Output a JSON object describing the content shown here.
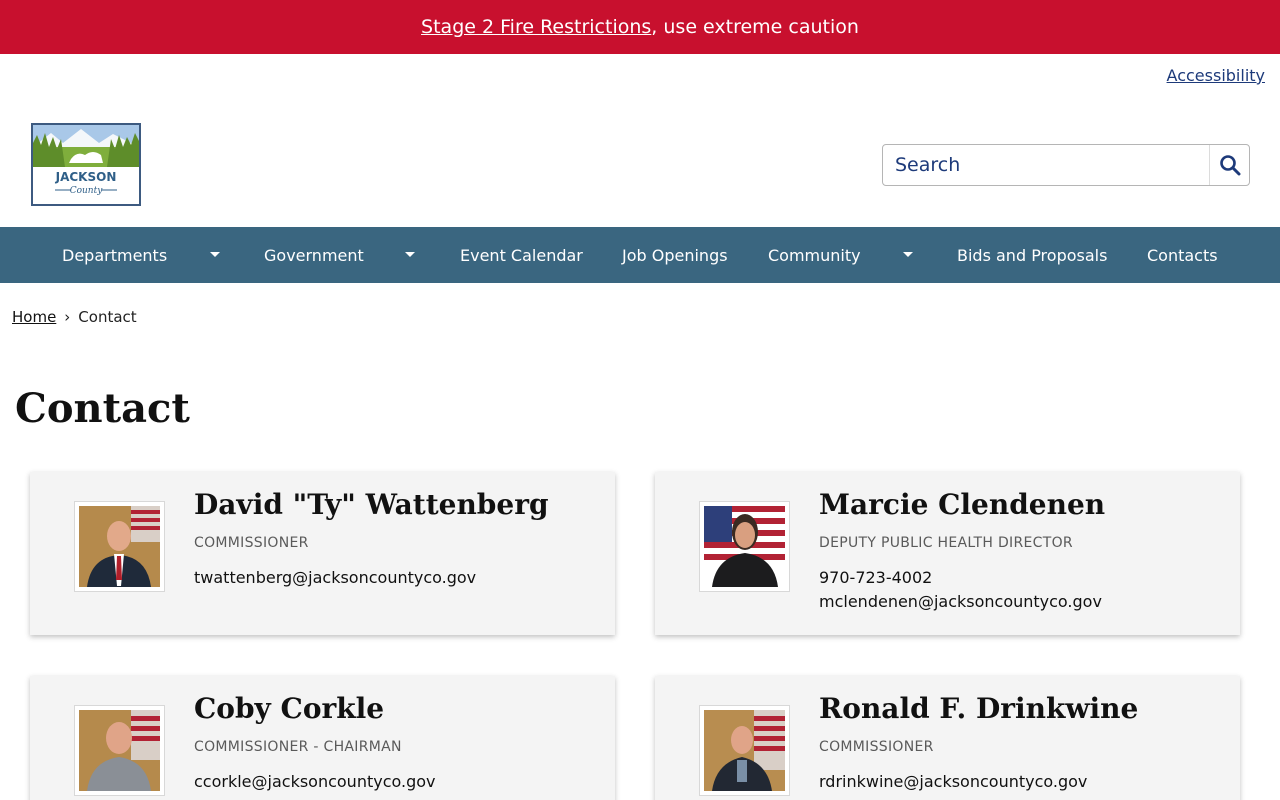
{
  "alert": {
    "link_text": "Stage 2 Fire Restrictions",
    "rest_text": ", use extreme caution"
  },
  "header": {
    "accessibility_label": "Accessibility",
    "logo_text": "JACKSON",
    "logo_subtext": "County",
    "search_placeholder": "Search"
  },
  "nav": {
    "items": [
      {
        "label": "Departments",
        "has_dropdown": true
      },
      {
        "label": "Government",
        "has_dropdown": true
      },
      {
        "label": "Event Calendar",
        "has_dropdown": false
      },
      {
        "label": "Job Openings",
        "has_dropdown": false
      },
      {
        "label": "Community",
        "has_dropdown": true
      },
      {
        "label": "Bids and Proposals",
        "has_dropdown": false
      },
      {
        "label": "Contacts",
        "has_dropdown": false
      }
    ]
  },
  "breadcrumb": {
    "home": "Home",
    "separator": "›",
    "current": "Contact"
  },
  "page": {
    "title": "Contact"
  },
  "contacts": [
    {
      "name": "David \"Ty\" Wattenberg",
      "role": "Commissioner",
      "phone": "",
      "email": "twattenberg@jacksoncountyco.gov"
    },
    {
      "name": "Marcie Clendenen",
      "role": "Deputy Public Health Director",
      "phone": "970-723-4002",
      "email": "mclendenen@jacksoncountyco.gov"
    },
    {
      "name": "Coby Corkle",
      "role": "Commissioner - Chairman",
      "phone": "",
      "email": "ccorkle@jacksoncountyco.gov"
    },
    {
      "name": "Ronald F. Drinkwine",
      "role": "Commissioner",
      "phone": "",
      "email": "rdrinkwine@jacksoncountyco.gov"
    }
  ],
  "colors": {
    "alert": "#c8102e",
    "nav": "#3a6680",
    "link": "#1d3a7a",
    "card": "#f4f4f4"
  }
}
